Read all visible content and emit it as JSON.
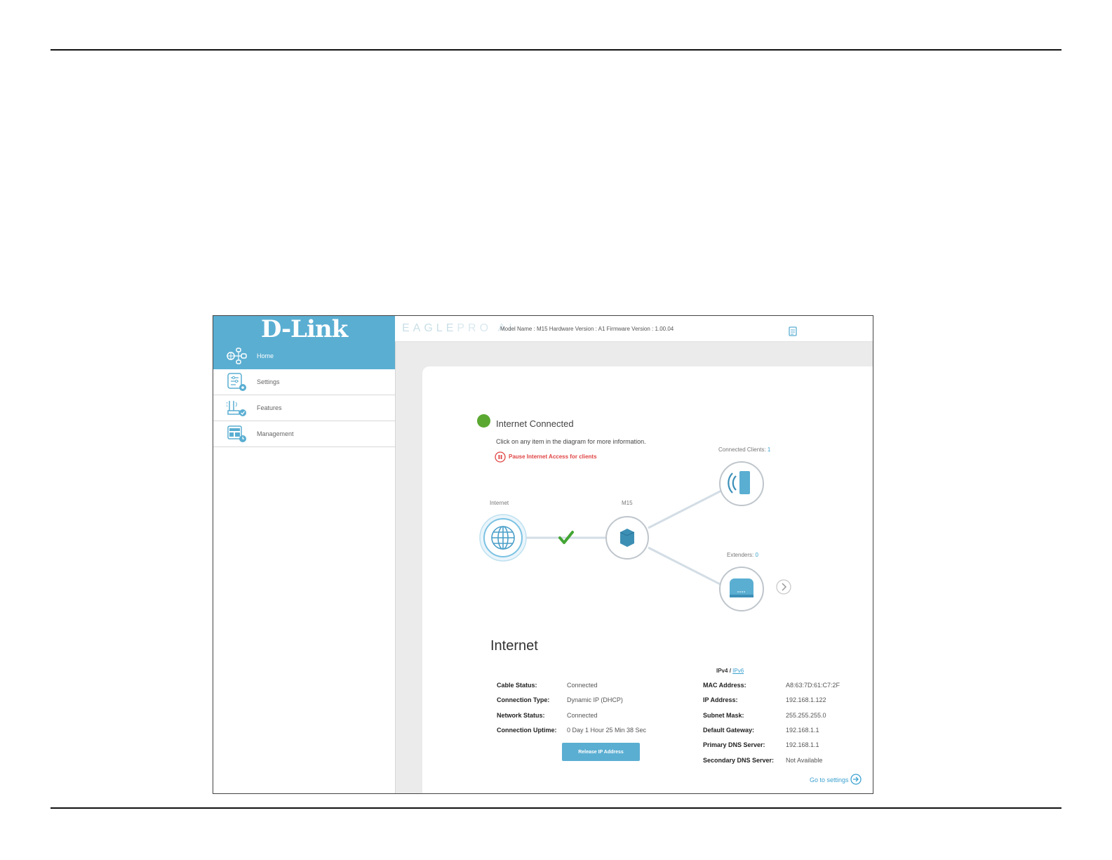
{
  "sidebar": {
    "logo": "D-Link",
    "items": [
      {
        "label": "Home",
        "icon": "home-network-icon",
        "active": true
      },
      {
        "label": "Settings",
        "icon": "settings-icon",
        "active": false
      },
      {
        "label": "Features",
        "icon": "features-icon",
        "active": false
      },
      {
        "label": "Management",
        "icon": "management-icon",
        "active": false
      }
    ]
  },
  "header": {
    "brand_a": "EAGLE",
    "brand_b": "PRO AI",
    "model_info": "Model Name : M15   Hardware Version : A1   Firmware Version : 1.00.04",
    "doc_icon": "document-icon"
  },
  "status": {
    "title": "Internet Connected",
    "hint": "Click on any item in the diagram for more information.",
    "pause_link": "Pause Internet Access for clients",
    "color": "#5aa832"
  },
  "diagram": {
    "internet_label": "Internet",
    "router_label": "M15",
    "clients_label": "Connected Clients:",
    "clients_count": "1",
    "extenders_label": "Extenders:",
    "extenders_count": "0"
  },
  "internet_section": {
    "title": "Internet",
    "ipv4": "IPv4",
    "sep": "/",
    "ipv6": "IPv6",
    "left": [
      {
        "label": "Cable Status:",
        "value": "Connected"
      },
      {
        "label": "Connection Type:",
        "value": "Dynamic IP (DHCP)"
      },
      {
        "label": "Network Status:",
        "value": "Connected"
      },
      {
        "label": "Connection Uptime:",
        "value": "0 Day 1 Hour 25 Min 38 Sec"
      }
    ],
    "right": [
      {
        "label": "MAC Address:",
        "value": "A8:63:7D:61:C7:2F"
      },
      {
        "label": "IP Address:",
        "value": "192.168.1.122"
      },
      {
        "label": "Subnet Mask:",
        "value": "255.255.255.0"
      },
      {
        "label": "Default Gateway:",
        "value": "192.168.1.1"
      },
      {
        "label": "Primary DNS Server:",
        "value": "192.168.1.1"
      },
      {
        "label": "Secondary DNS Server:",
        "value": "Not Available"
      }
    ],
    "release_button": "Release IP Address",
    "go_settings": "Go to settings"
  },
  "colors": {
    "accent": "#5aaed2",
    "link": "#3ba1d0",
    "alert": "#e04444"
  }
}
